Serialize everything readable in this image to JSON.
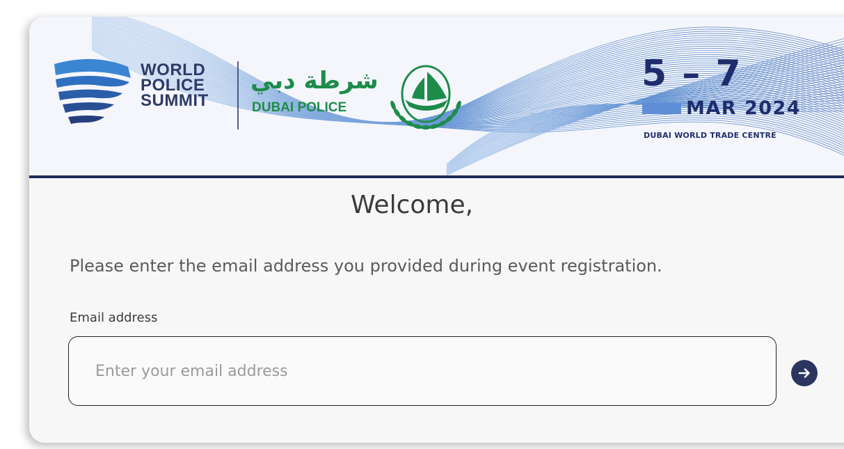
{
  "header": {
    "logo_lines": [
      "WORLD",
      "POLICE",
      "SUMMIT"
    ],
    "partner_arabic": "شرطة دبي",
    "partner_english": "DUBAI POLICE",
    "date_days": "5 – 7",
    "date_month": "MAR 2024",
    "venue": "DUBAI WORLD TRADE CENTRE",
    "colors": {
      "navy": "#1f2d6e",
      "green": "#1d8c4a",
      "accent_blue": "#5e8fd6"
    }
  },
  "main": {
    "welcome": "Welcome,",
    "instruction": "Please enter the email address you provided during event registration.",
    "email_label": "Email address",
    "email_placeholder": "Enter your email address",
    "email_value": "",
    "submit_icon": "arrow-right-icon"
  }
}
